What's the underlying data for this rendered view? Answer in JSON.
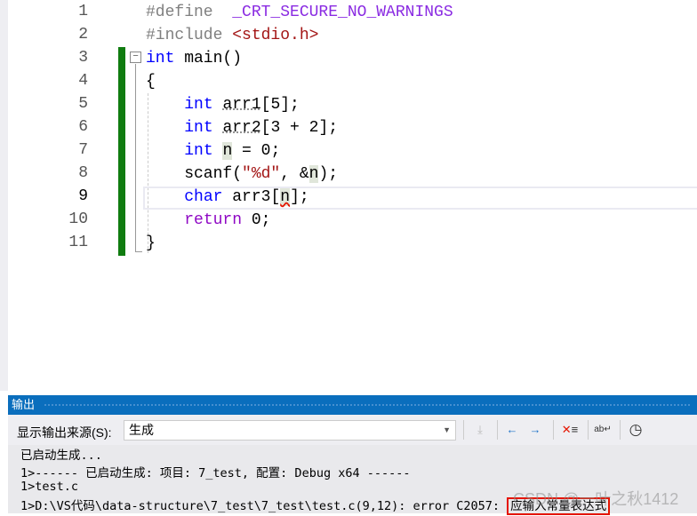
{
  "editor": {
    "line_numbers": [
      "1",
      "2",
      "3",
      "4",
      "5",
      "6",
      "7",
      "8",
      "9",
      "10",
      "11"
    ],
    "current_line": "9",
    "lines": [
      [
        {
          "t": "#define  ",
          "c": "pp"
        },
        {
          "t": "_CRT_SECURE_NO_WARNINGS",
          "c": "mac"
        }
      ],
      [
        {
          "t": "#include ",
          "c": "pp"
        },
        {
          "t": "<stdio.h>",
          "c": "inc"
        }
      ],
      [
        {
          "t": "int",
          "c": "kw"
        },
        {
          "t": " main()",
          "c": ""
        }
      ],
      [
        {
          "t": "{",
          "c": ""
        }
      ],
      [
        {
          "t": "    ",
          "c": ""
        },
        {
          "t": "int",
          "c": "kw"
        },
        {
          "t": " ",
          "c": ""
        },
        {
          "t": "arr1",
          "c": "dots"
        },
        {
          "t": "[5];",
          "c": ""
        }
      ],
      [
        {
          "t": "    ",
          "c": ""
        },
        {
          "t": "int",
          "c": "kw"
        },
        {
          "t": " ",
          "c": ""
        },
        {
          "t": "arr2",
          "c": "dots"
        },
        {
          "t": "[3 + 2];",
          "c": ""
        }
      ],
      [
        {
          "t": "    ",
          "c": ""
        },
        {
          "t": "int",
          "c": "kw"
        },
        {
          "t": " ",
          "c": ""
        },
        {
          "t": "n",
          "c": "hl"
        },
        {
          "t": " = 0;",
          "c": ""
        }
      ],
      [
        {
          "t": "    scanf(",
          "c": ""
        },
        {
          "t": "\"%d\"",
          "c": "str"
        },
        {
          "t": ", &",
          "c": ""
        },
        {
          "t": "n",
          "c": "hl"
        },
        {
          "t": ");",
          "c": ""
        }
      ],
      [
        {
          "t": "    ",
          "c": ""
        },
        {
          "t": "char",
          "c": "kw"
        },
        {
          "t": " arr3[",
          "c": ""
        },
        {
          "t": "n",
          "c": "hl squig"
        },
        {
          "t": "];",
          "c": ""
        }
      ],
      [
        {
          "t": "    ",
          "c": ""
        },
        {
          "t": "return",
          "c": "ret"
        },
        {
          "t": " 0;",
          "c": ""
        }
      ],
      [
        {
          "t": "}",
          "c": ""
        }
      ]
    ]
  },
  "output": {
    "title": "输出",
    "source_label": "显示输出来源(S):",
    "source_value": "生成",
    "lines": [
      "已启动生成...",
      "1>------ 已启动生成: 项目: 7_test, 配置: Debug x64 ------",
      "1>test.c",
      "1>D:\\VS代码\\data-structure\\7_test\\7_test\\test.c(9,12): error C2057: "
    ],
    "error_highlight": "应输入常量表达式"
  },
  "watermark": "CSDN @一叶之秋1412"
}
